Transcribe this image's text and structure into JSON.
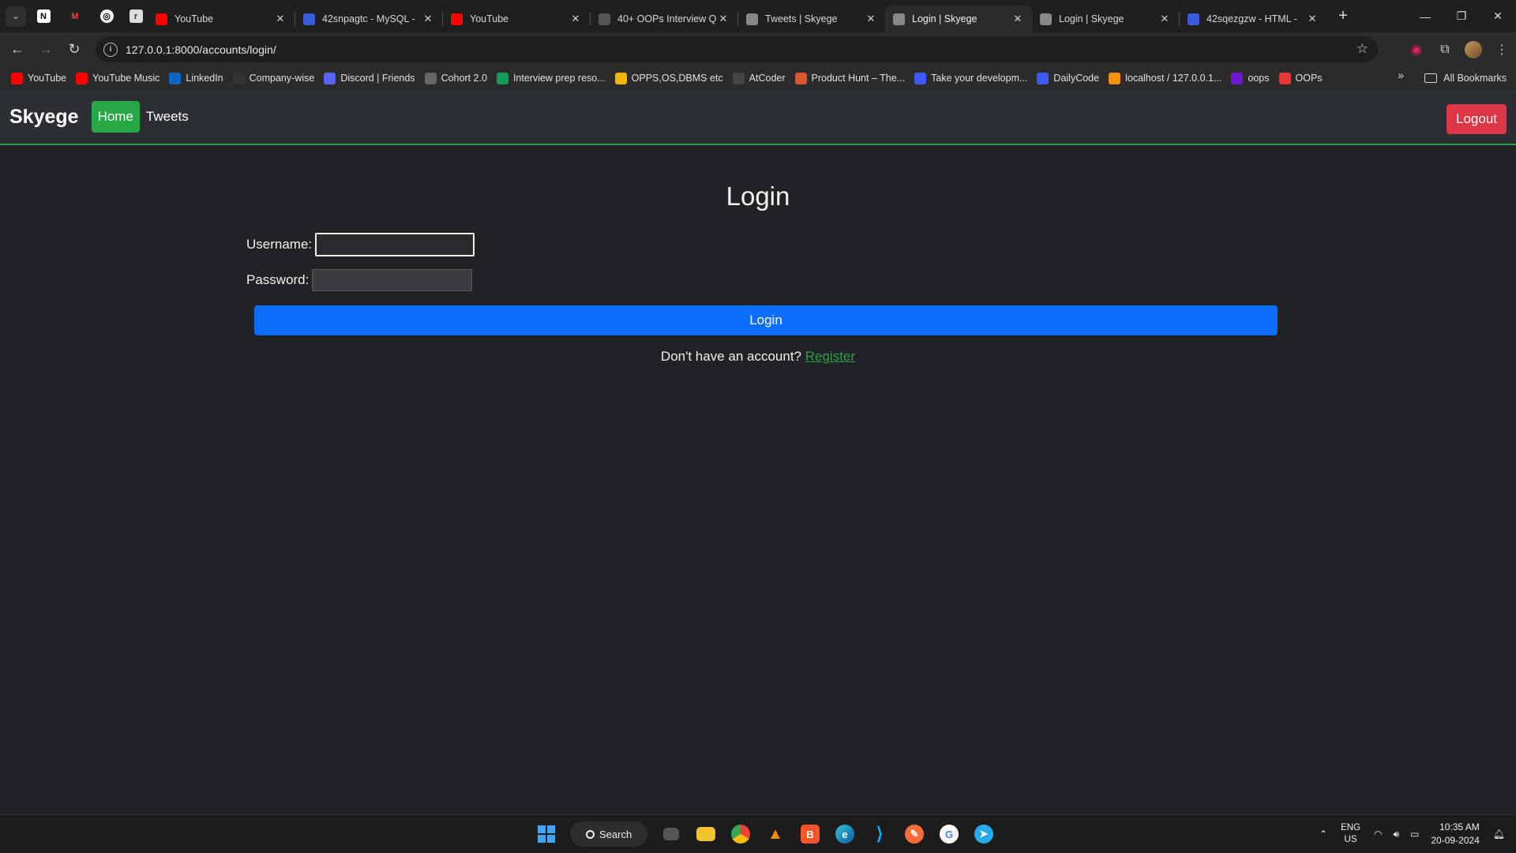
{
  "browser": {
    "tabs": [
      {
        "title": "YouTube",
        "favicon": "youtube-icon",
        "color": "#ff0000",
        "active": false
      },
      {
        "title": "42snpagtc - MySQL -",
        "favicon": "code-icon",
        "color": "#3b5bdb",
        "active": false
      },
      {
        "title": "YouTube",
        "favicon": "youtube-icon",
        "color": "#ff0000",
        "active": false
      },
      {
        "title": "40+ OOPs Interview Q",
        "favicon": "mountain-icon",
        "color": "#555555",
        "active": false
      },
      {
        "title": "Tweets | Skyege",
        "favicon": "globe-icon",
        "color": "#888888",
        "active": false
      },
      {
        "title": "Login | Skyege",
        "favicon": "globe-icon",
        "color": "#888888",
        "active": true
      },
      {
        "title": "Login | Skyege",
        "favicon": "globe-icon",
        "color": "#888888",
        "active": false
      },
      {
        "title": "42sqezgzw - HTML -",
        "favicon": "code-icon",
        "color": "#3b5bdb",
        "active": false
      }
    ],
    "url": "127.0.0.1:8000/accounts/login/",
    "bookmarks": [
      {
        "label": "YouTube",
        "icon": "youtube-icon",
        "color": "#ff0000"
      },
      {
        "label": "YouTube Music",
        "icon": "youtube-music-icon",
        "color": "#ff0000"
      },
      {
        "label": "LinkedIn",
        "icon": "linkedin-icon",
        "color": "#0a66c2"
      },
      {
        "label": "Company-wise",
        "icon": "github-icon",
        "color": "#333333"
      },
      {
        "label": "Discord | Friends",
        "icon": "discord-icon",
        "color": "#5865f2"
      },
      {
        "label": "Cohort 2.0",
        "icon": "cohort-icon",
        "color": "#666666"
      },
      {
        "label": "Interview prep reso...",
        "icon": "sheets-icon",
        "color": "#0f9d58"
      },
      {
        "label": "OPPS,OS,DBMS etc",
        "icon": "drive-icon",
        "color": "#f4b400"
      },
      {
        "label": "AtCoder",
        "icon": "atcoder-icon",
        "color": "#444444"
      },
      {
        "label": "Product Hunt – The...",
        "icon": "producthunt-icon",
        "color": "#da552f"
      },
      {
        "label": "Take your developm...",
        "icon": "dev-icon",
        "color": "#3d5afe"
      },
      {
        "label": "DailyCode",
        "icon": "dailycode-icon",
        "color": "#3d5afe"
      },
      {
        "label": "localhost / 127.0.0.1...",
        "icon": "phpmyadmin-icon",
        "color": "#f29111"
      },
      {
        "label": "oops",
        "icon": "oops-icon",
        "color": "#6a1bd1"
      },
      {
        "label": "OOPs",
        "icon": "oops-v-icon",
        "color": "#e53935"
      }
    ],
    "all_bookmarks": "All Bookmarks"
  },
  "app": {
    "brand": "Skyege",
    "nav": {
      "home": "Home",
      "tweets": "Tweets",
      "logout": "Logout"
    },
    "colors": {
      "home": "#28a745",
      "logout": "#dc3545",
      "primary": "#0d6efd",
      "accent": "#2e9e4b"
    },
    "login": {
      "title": "Login",
      "username_label": "Username:",
      "username_value": "",
      "password_label": "Password:",
      "password_value": "",
      "submit": "Login",
      "register_prompt": "Don't have an account?",
      "register_link": "Register"
    }
  },
  "taskbar": {
    "search": "Search",
    "lang_top": "ENG",
    "lang_bottom": "US",
    "time": "10:35 AM",
    "date": "20-09-2024"
  }
}
